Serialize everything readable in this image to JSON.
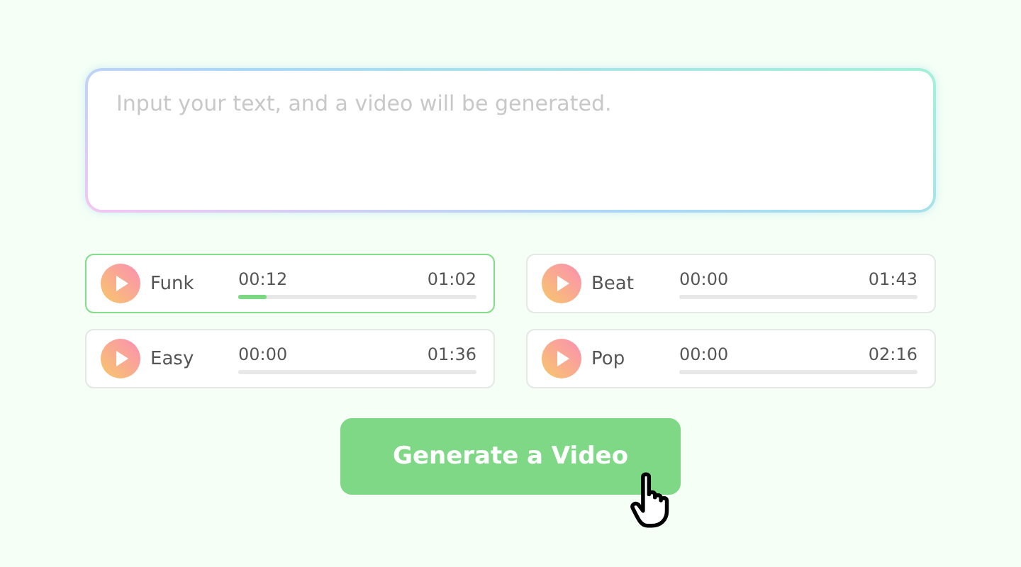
{
  "prompt": {
    "placeholder": "Input your text, and a video will be generated."
  },
  "tracks": [
    {
      "name": "Funk",
      "elapsed": "00:12",
      "duration": "01:02",
      "level": 0.12,
      "selected": true
    },
    {
      "name": "Beat",
      "elapsed": "00:00",
      "duration": "01:43",
      "selected": false
    },
    {
      "name": "Easy",
      "elapsed": "00:00",
      "duration": "01:36",
      "selected": false
    },
    {
      "name": "Pop",
      "elapsed": "00:00",
      "duration": "02:16",
      "selected": false
    }
  ],
  "generate_button": {
    "label": "Generate a Video"
  }
}
